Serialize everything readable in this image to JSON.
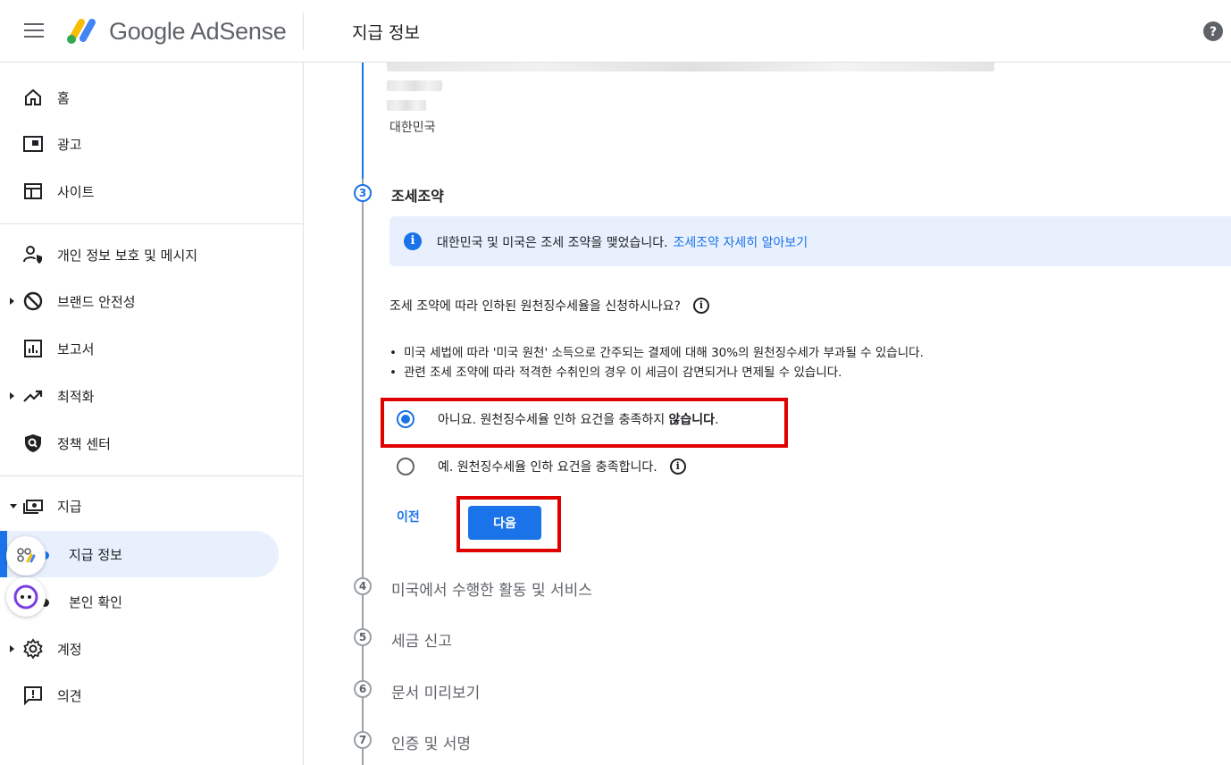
{
  "header": {
    "logo_text": "Google AdSense",
    "page_title": "지급 정보"
  },
  "sidebar": {
    "items": [
      {
        "label": "홈",
        "icon": "home-icon"
      },
      {
        "label": "광고",
        "icon": "ads-icon"
      },
      {
        "label": "사이트",
        "icon": "sites-icon"
      },
      {
        "label": "개인 정보 보호 및 메시지",
        "icon": "privacy-icon"
      },
      {
        "label": "브랜드 안전성",
        "icon": "block-icon"
      },
      {
        "label": "보고서",
        "icon": "report-icon"
      },
      {
        "label": "최적화",
        "icon": "trend-icon"
      },
      {
        "label": "정책 센터",
        "icon": "policy-icon"
      },
      {
        "label": "지급",
        "icon": "payments-icon"
      },
      {
        "label": "지급 정보",
        "icon": "dot-icon"
      },
      {
        "label": "본인 확인",
        "icon": "dot-icon"
      },
      {
        "label": "계정",
        "icon": "gear-icon"
      },
      {
        "label": "의견",
        "icon": "feedback-icon"
      }
    ]
  },
  "main": {
    "country": "대한민국",
    "steps": [
      {
        "num": "3",
        "title": "조세조약"
      },
      {
        "num": "4",
        "title": "미국에서 수행한 활동 및 서비스"
      },
      {
        "num": "5",
        "title": "세금 신고"
      },
      {
        "num": "6",
        "title": "문서 미리보기"
      },
      {
        "num": "7",
        "title": "인증 및 서명"
      }
    ],
    "info_text": "대한민국 및 미국은 조세 조약을 맺었습니다.",
    "info_link": "조세조약 자세히 알아보기",
    "question": "조세 조약에 따라 인하된 원천징수세율을 신청하시나요?",
    "bullets": [
      "미국 세법에 따라 '미국 원천' 소득으로 간주되는 결제에 대해 30%의 원천징수세가 부과될 수 있습니다.",
      "관련 조세 조약에 따라 적격한 수취인의 경우 이 세금이 감면되거나 면제될 수 있습니다."
    ],
    "option_no_prefix": "아니요. 원천징수세율 인하 요건을 충족하지 ",
    "option_no_bold": "않습니다",
    "option_no_suffix": ".",
    "option_yes": "예. 원천징수세율 인하 요건을 충족합니다.",
    "prev_label": "이전",
    "next_label": "다음"
  }
}
